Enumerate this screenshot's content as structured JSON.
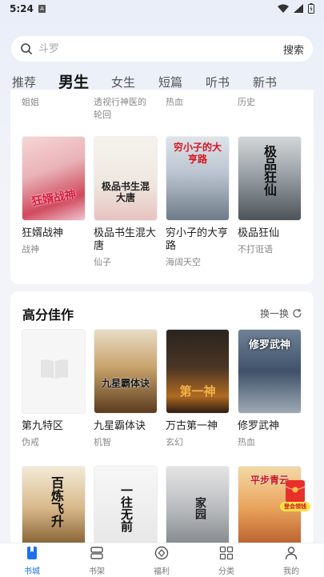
{
  "status": {
    "time": "5:24"
  },
  "search": {
    "placeholder": "斗罗",
    "button": "搜索"
  },
  "tabs": [
    "推荐",
    "男生",
    "女生",
    "短篇",
    "听书",
    "新书"
  ],
  "partial_row": [
    {
      "t1": "姐姐",
      "t2": ""
    },
    {
      "t1": "透视行神医的",
      "t2": "轮回"
    },
    {
      "t1": "热血",
      "t2": ""
    },
    {
      "t1": "历史",
      "t2": ""
    }
  ],
  "row1": [
    {
      "title": "狂婿战神",
      "sub": "战神",
      "cover_text": "狂婿战神"
    },
    {
      "title": "极品书生混大唐",
      "sub": "仙子",
      "cover_text": "极品书生混大唐"
    },
    {
      "title": "穷小子的大亨路",
      "sub": "海阔天空",
      "cover_text": "穷小子的大亨路"
    },
    {
      "title": "极品狂仙",
      "sub": "不打诳语",
      "cover_text": "极品狂仙"
    }
  ],
  "section": {
    "title": "高分佳作",
    "refresh": "换一换"
  },
  "row2": [
    {
      "title": "第九特区",
      "sub": "伪戒",
      "cover_text": ""
    },
    {
      "title": "九星霸体诀",
      "sub": "机智",
      "cover_text": "九星霸体诀"
    },
    {
      "title": "万古第一神",
      "sub": "玄幻",
      "cover_text": "第一神"
    },
    {
      "title": "修罗武神",
      "sub": "热血",
      "cover_text": "修罗武神"
    }
  ],
  "row3": [
    {
      "cover_text": "百炼飞升"
    },
    {
      "cover_text": "一往无前"
    },
    {
      "cover_text": "家园"
    },
    {
      "cover_text": "平步青云"
    }
  ],
  "redpacket": "登会领钱",
  "nav": [
    "书城",
    "书架",
    "福利",
    "分类",
    "我的"
  ],
  "colors": {
    "accent": "#1e6ff0"
  }
}
